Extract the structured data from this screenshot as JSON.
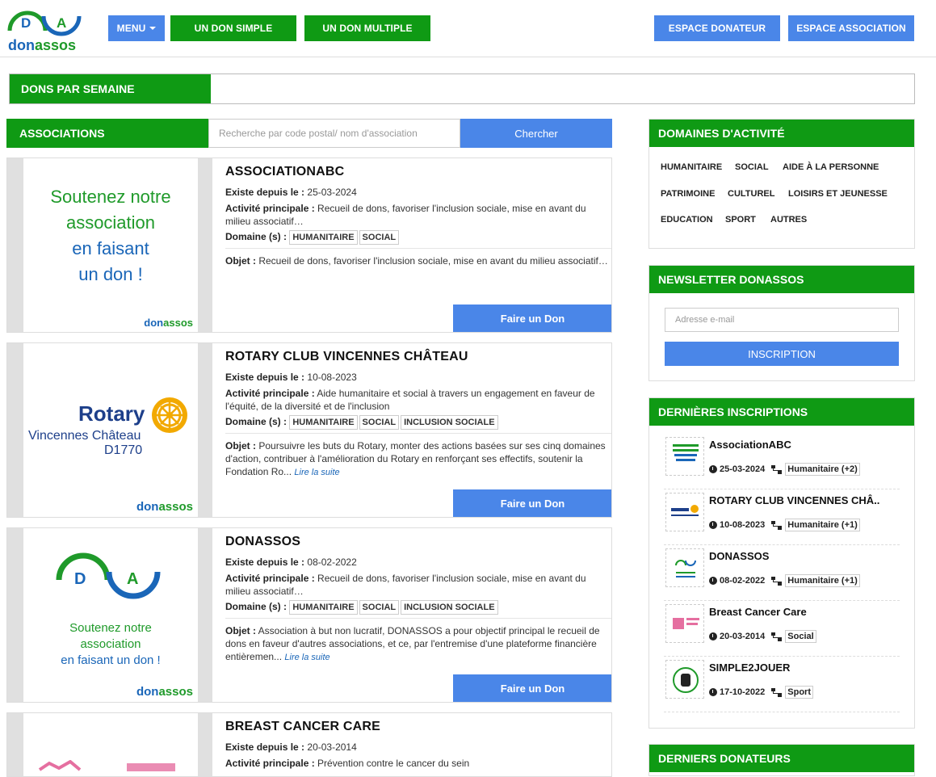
{
  "header": {
    "logo_letter_left": "D",
    "logo_letter_right": "A",
    "logo_text_1": "don",
    "logo_text_2": "assos",
    "menu_label": "MENU",
    "btn_don_simple": "UN DON SIMPLE",
    "btn_don_multiple": "UN DON MULTIPLE",
    "btn_espace_donateur": "ESPACE DONATEUR",
    "btn_espace_association": "ESPACE ASSOCIATION"
  },
  "weekly": {
    "label": "DONS PAR SEMAINE"
  },
  "associations_bar": {
    "label": "ASSOCIATIONS",
    "search_placeholder": "Recherche par code postal/ nom d'association",
    "search_button": "Chercher"
  },
  "labels": {
    "since": "Existe depuis le :",
    "activity": "Activité principale :",
    "domains": "Domaine (s) :",
    "object": "Objet :",
    "read_more": "Lire la suite",
    "donate": "Faire un Don"
  },
  "cards": [
    {
      "title": "ASSOCIATIONABC",
      "since": "25-03-2024",
      "activity": "Recueil de dons, favoriser l'inclusion sociale, mise en avant du milieu associatif…",
      "domains": [
        "HUMANITAIRE",
        "SOCIAL"
      ],
      "object": "Recueil de dons, favoriser l'inclusion sociale, mise en avant du milieu associatif…",
      "image_text": [
        "Soutenez notre",
        "association",
        "en faisant",
        "un don  !"
      ],
      "image_brand": [
        "don",
        "assos"
      ]
    },
    {
      "title": "ROTARY CLUB VINCENNES CHÂTEAU",
      "since": "10-08-2023",
      "activity": "Aide humanitaire et social à travers un engagement en faveur de l'équité, de la diversité et de l'inclusion",
      "domains": [
        "HUMANITAIRE",
        "SOCIAL",
        "INCLUSION SOCIALE"
      ],
      "object": "Poursuivre les buts du Rotary, monter des actions basées sur ses cinq domaines d'action, contribuer à l'amélioration du Rotary en renforçant ses effectifs, soutenir la Fondation Ro...",
      "image_text": [
        "Rotary",
        "Vincennes Château",
        "D1770"
      ],
      "image_brand": [
        "don",
        "assos"
      ]
    },
    {
      "title": "DONASSOS",
      "since": "08-02-2022",
      "activity": "Recueil de dons, favoriser l'inclusion sociale, mise en avant du milieu associatif…",
      "domains": [
        "HUMANITAIRE",
        "SOCIAL",
        "INCLUSION SOCIALE"
      ],
      "object": "Association à but non lucratif, DONASSOS a pour objectif principal le recueil de dons en faveur d'autres associations, et ce, par l'entremise d'une plateforme financière entièremen...",
      "image_text": [
        "D",
        "A",
        "Soutenez notre",
        "association",
        "en faisant un don  !"
      ],
      "image_brand": [
        "don",
        "assos"
      ]
    },
    {
      "title": "BREAST CANCER CARE",
      "since": "20-03-2014",
      "activity": "Prévention contre le cancer du sein"
    }
  ],
  "domaines": {
    "title": "DOMAINES D'ACTIVITÉ",
    "items": [
      "HUMANITAIRE",
      "SOCIAL",
      "AIDE À LA PERSONNE",
      "PATRIMOINE",
      "CULTUREL",
      "LOISIRS ET JEUNESSE",
      "EDUCATION",
      "SPORT",
      "AUTRES"
    ]
  },
  "newsletter": {
    "title": "NEWSLETTER DONASSOS",
    "email_placeholder": "Adresse e-mail",
    "button": "INSCRIPTION"
  },
  "inscriptions": {
    "title": "DERNIÈRES INSCRIPTIONS",
    "items": [
      {
        "name": "AssociationABC",
        "date": "25-03-2024",
        "domain": "Humanitaire (+2)"
      },
      {
        "name": "ROTARY CLUB VINCENNES CHÂ..",
        "date": "10-08-2023",
        "domain": "Humanitaire (+1)"
      },
      {
        "name": "DONASSOS",
        "date": "08-02-2022",
        "domain": "Humanitaire (+1)"
      },
      {
        "name": "Breast Cancer Care",
        "date": "20-03-2014",
        "domain": "Social"
      },
      {
        "name": "SIMPLE2JOUER",
        "date": "17-10-2022",
        "domain": "Sport"
      }
    ]
  },
  "donateurs": {
    "title": "DERNIERS DONATEURS"
  },
  "colors": {
    "green": "#0f9a14",
    "blue": "#4a86e8",
    "brand_blue": "#1a66b8",
    "brand_green": "#1f9a2a"
  }
}
